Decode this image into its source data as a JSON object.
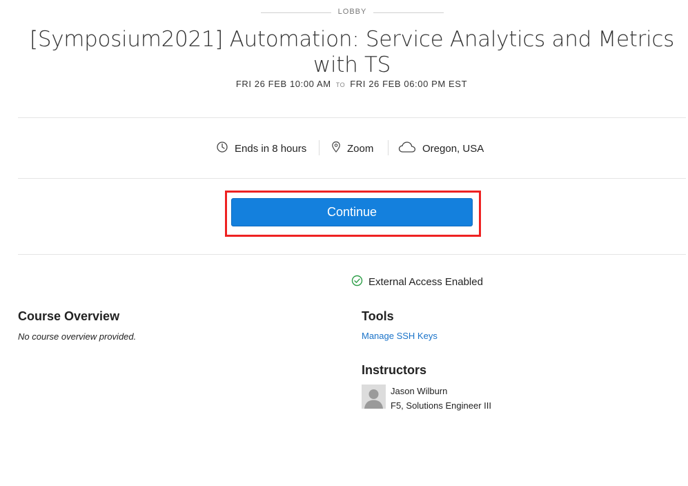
{
  "header": {
    "lobby_label": "LOBBY",
    "title": "[Symposium2021] Automation: Service Analytics and Metrics with TS",
    "start": "FRI 26 FEB 10:00 AM",
    "to_label": "TO",
    "end": "FRI 26 FEB 06:00 PM EST"
  },
  "info": {
    "ends": {
      "icon": "clock-icon",
      "text": "Ends in 8 hours"
    },
    "location": {
      "icon": "location-pin-icon",
      "text": "Zoom"
    },
    "region": {
      "icon": "cloud-icon",
      "text": "Oregon, USA"
    }
  },
  "actions": {
    "continue_label": "Continue",
    "highlight_color": "#ee2222",
    "button_color": "#1480dd"
  },
  "access": {
    "icon": "check-circle-icon",
    "text": "External Access Enabled",
    "icon_color": "#2e9e48"
  },
  "overview": {
    "title": "Course Overview",
    "text": "No course overview provided."
  },
  "tools": {
    "title": "Tools",
    "link": "Manage SSH Keys",
    "link_color": "#1a73c9"
  },
  "instructors": {
    "title": "Instructors",
    "items": [
      {
        "name": "Jason Wilburn",
        "role": "F5, Solutions Engineer III",
        "avatar_icon": "avatar-placeholder-icon"
      }
    ]
  }
}
